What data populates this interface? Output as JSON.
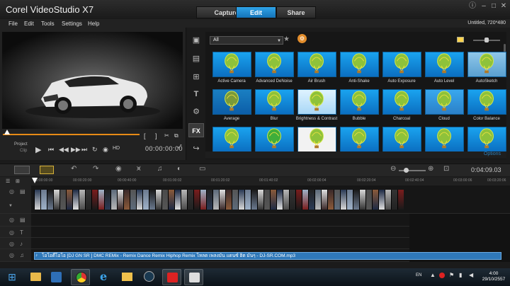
{
  "app": {
    "title": "Corel VideoStudio X7",
    "project_info": "Untitled, 720*480"
  },
  "tabs": [
    {
      "label": "Capture",
      "active": false
    },
    {
      "label": "Edit",
      "active": true
    },
    {
      "label": "Share",
      "active": false
    }
  ],
  "menu": [
    "File",
    "Edit",
    "Tools",
    "Settings",
    "Help"
  ],
  "preview": {
    "project_label": "Project",
    "clip_label": "Clip",
    "timecode": "00:00:00:00",
    "hd_label": "HD",
    "in_bracket": "[",
    "out_bracket": "]"
  },
  "library": {
    "filter_value": "All",
    "thumbnail_labels": [
      "Active Camera",
      "Advanced DeNoise",
      "Air Brush",
      "Anti-Shake",
      "Auto Exposure",
      "Auto Level",
      "AutoSketch",
      "Average",
      "Blur",
      "Brightness & Contrast",
      "Bubble",
      "Charcoal",
      "Cloud",
      "Color Balance",
      "",
      "",
      "",
      "",
      "",
      "",
      ""
    ],
    "options_label": "Options"
  },
  "timeline": {
    "time": "0:04:09.03",
    "ruler": [
      "00:00:00:00",
      "00:00:20:00",
      "00:00:40:00",
      "00:01:00:02",
      "00:01:20:02",
      "00:01:40:02",
      "00:02:00:04",
      "00:02:20:04",
      "00:02:40:04",
      "00:03:00:06",
      "00:03:20:06"
    ],
    "audio_clip": "โอโอดี้โอโอ [DJ GN SR ] DMC REMix - Remix Dance Remix Hiphop Remix โหลด เพลงมัน แดนซ์ ฮิต มันๆ - DJ-SR.COM.mp3"
  },
  "taskbar": {
    "lang": "EN",
    "time": "4:00",
    "date": "29/10/2557"
  },
  "colors": {
    "accent": "#1c8ad6",
    "scrub": "#e78a16",
    "audio": "#2f78b9"
  }
}
